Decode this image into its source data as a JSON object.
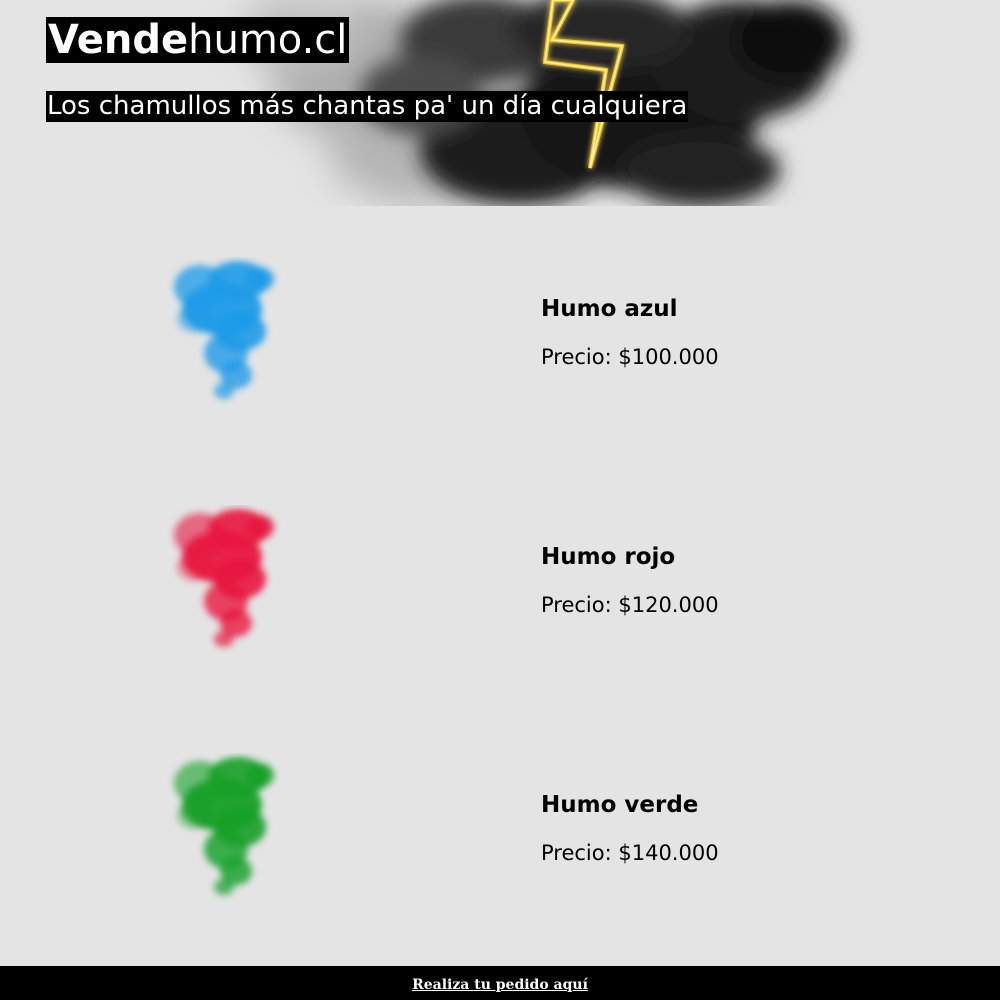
{
  "header": {
    "title_bold": "Vende",
    "title_regular": "humo.cl",
    "tagline": "Los chamullos más chantas pa' un día cualquiera",
    "hero_icon": "lightning-bolt-icon",
    "hero_background": "dark-smoke-cloud",
    "bolt_color": "#f5c518"
  },
  "products": [
    {
      "name": "Humo azul",
      "price": "Precio: $100.000",
      "image": "blue-smoke-image",
      "color": "#1e9be8"
    },
    {
      "name": "Humo rojo",
      "price": "Precio: $120.000",
      "image": "red-smoke-image",
      "color": "#e8173f"
    },
    {
      "name": "Humo verde",
      "price": "Precio: $140.000",
      "image": "green-smoke-image",
      "color": "#14a028"
    }
  ],
  "footer": {
    "order_link": "Realiza tu pedido aquí"
  },
  "colors": {
    "page_background": "#e4e4e4",
    "footer_background": "#000000",
    "title_background": "#000000",
    "title_text": "#ffffff"
  }
}
